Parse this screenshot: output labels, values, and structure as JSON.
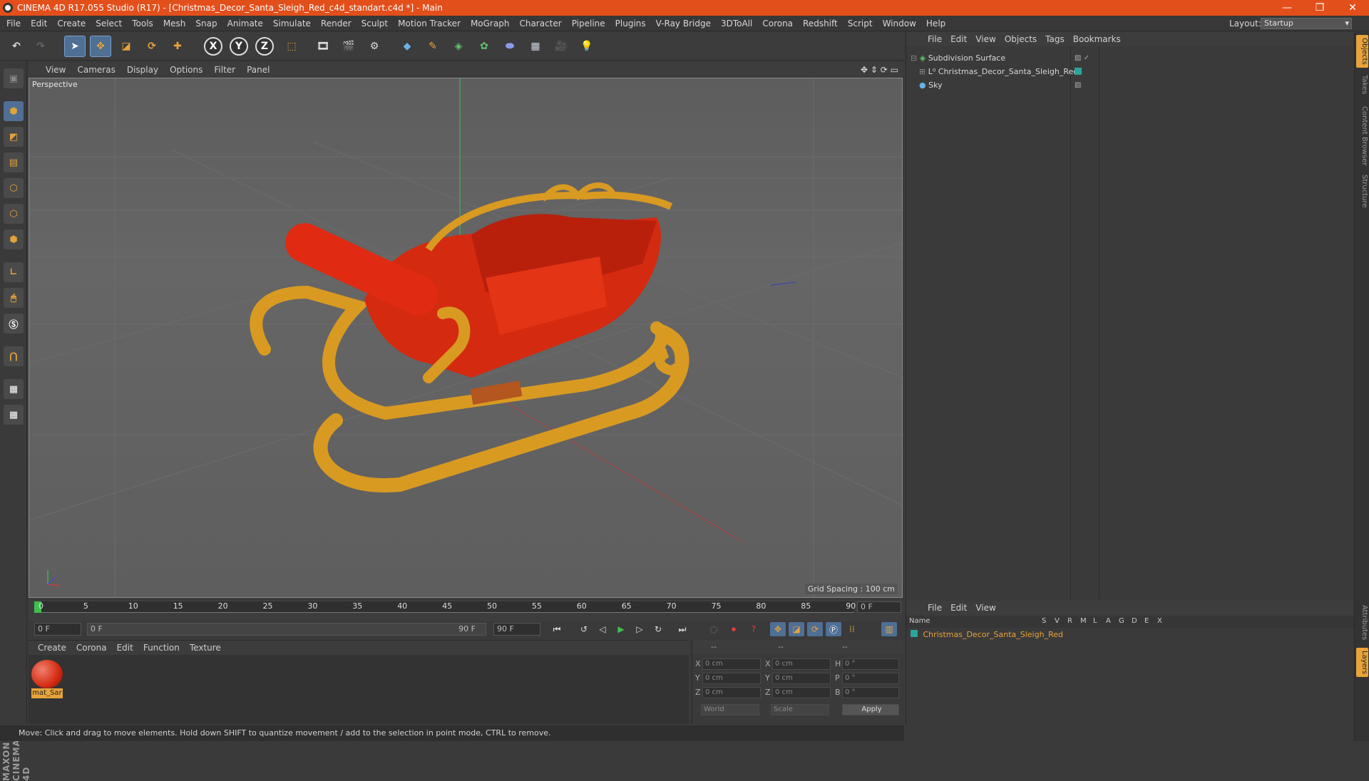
{
  "window": {
    "title": "CINEMA 4D R17.055 Studio (R17) - [Christmas_Decor_Santa_Sleigh_Red_c4d_standart.c4d *] - Main",
    "minimize": "—",
    "restore": "❐",
    "close": "✕"
  },
  "menu": [
    "File",
    "Edit",
    "Create",
    "Select",
    "Tools",
    "Mesh",
    "Snap",
    "Animate",
    "Simulate",
    "Render",
    "Sculpt",
    "Motion Tracker",
    "MoGraph",
    "Character",
    "Pipeline",
    "Plugins",
    "V-Ray Bridge",
    "3DToAll",
    "Corona",
    "Redshift",
    "Script",
    "Window",
    "Help"
  ],
  "layout": {
    "label": "Layout:",
    "value": "Startup"
  },
  "toolbar": {
    "x": "X",
    "y": "Y",
    "z": "Z"
  },
  "viewport": {
    "menu": [
      "View",
      "Cameras",
      "Display",
      "Options",
      "Filter",
      "Panel"
    ],
    "label": "Perspective",
    "grid_spacing": "Grid Spacing : 100 cm"
  },
  "timeline": {
    "ticks": [
      "0",
      "5",
      "10",
      "15",
      "20",
      "25",
      "30",
      "35",
      "40",
      "45",
      "50",
      "55",
      "60",
      "65",
      "70",
      "75",
      "80",
      "85",
      "90"
    ],
    "current_frame": "0 F",
    "start_field": "0 F",
    "range_start": "0 F",
    "range_end": "90 F",
    "end_field": "90 F"
  },
  "material_manager": {
    "menu": [
      "Create",
      "Corona",
      "Edit",
      "Function",
      "Texture"
    ],
    "material_name": "mat_Sar"
  },
  "coordinates": {
    "header": [
      "--",
      "--",
      "--"
    ],
    "rows": [
      {
        "a": "X",
        "av": "0 cm",
        "b": "X",
        "bv": "0 cm",
        "c": "H",
        "cv": "0 °"
      },
      {
        "a": "Y",
        "av": "0 cm",
        "b": "Y",
        "bv": "0 cm",
        "c": "P",
        "cv": "0 °"
      },
      {
        "a": "Z",
        "av": "0 cm",
        "b": "Z",
        "bv": "0 cm",
        "c": "B",
        "cv": "0 °"
      }
    ],
    "world": "World",
    "scale": "Scale",
    "apply": "Apply"
  },
  "status": "Move: Click and drag to move elements. Hold down SHIFT to quantize movement / add to the selection in point mode, CTRL to remove.",
  "object_manager": {
    "menu": [
      "File",
      "Edit",
      "View",
      "Objects",
      "Tags",
      "Bookmarks"
    ],
    "objects": [
      "Subdivision Surface",
      "Christmas_Decor_Santa_Sleigh_Red",
      "Sky"
    ]
  },
  "layer_manager": {
    "menu": [
      "File",
      "Edit",
      "View"
    ],
    "columns": [
      "Name",
      "S",
      "V",
      "R",
      "M",
      "L",
      "A",
      "G",
      "D",
      "E",
      "X"
    ],
    "layer_name": "Christmas_Decor_Santa_Sleigh_Red"
  },
  "right_tabs": [
    "Objects",
    "Takes",
    "Content Browser",
    "Structure"
  ],
  "right_tabs_bottom": [
    "Attributes",
    "Layers"
  ],
  "maxon": "MAXON CINEMA 4D",
  "colors": {
    "accent": "#e34f1b",
    "sleigh_red": "#d42a10",
    "sleigh_gold": "#d99a22",
    "layer_name": "#e8a33a"
  }
}
